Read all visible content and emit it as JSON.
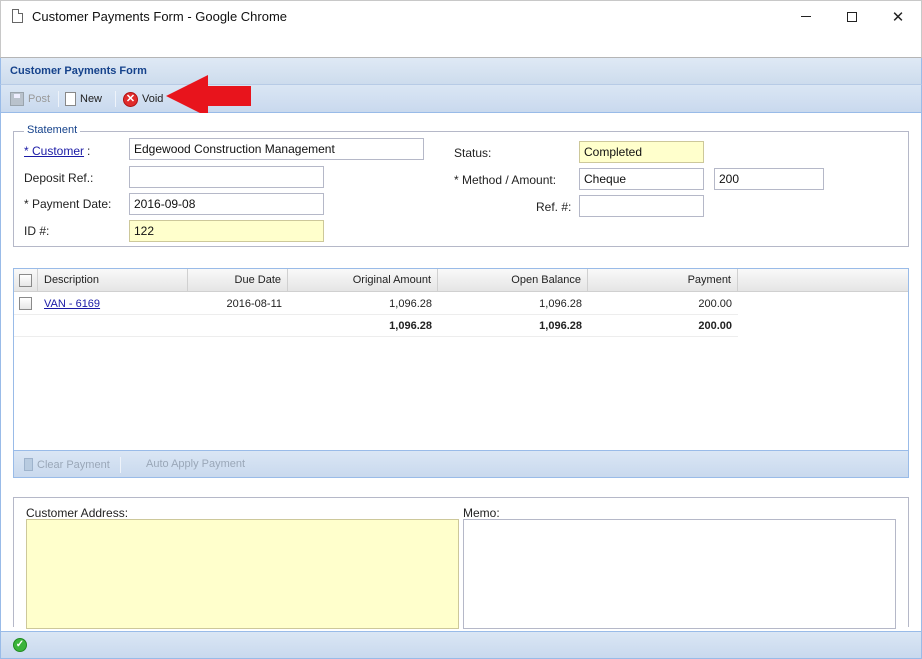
{
  "window": {
    "title": "Customer Payments Form - Google Chrome",
    "minimize_glyph": "",
    "maximize_glyph": "",
    "close_glyph": "✕"
  },
  "panel": {
    "title": "Customer Payments Form"
  },
  "toolbar": {
    "post_label": "Post",
    "new_label": "New",
    "void_label": "Void"
  },
  "statement": {
    "legend": "Statement",
    "customer_label": "* Customer",
    "customer_value": "Edgewood Construction Management",
    "deposit_ref_label": "Deposit Ref.:",
    "deposit_ref_value": "",
    "payment_date_label": "* Payment Date:",
    "payment_date_value": "2016-09-08",
    "id_label": "ID #:",
    "id_value": "122",
    "status_label": "Status:",
    "status_value": "Completed",
    "method_amount_label": "* Method / Amount:",
    "method_value": "Cheque",
    "amount_value": "200",
    "ref_label": "Ref. #:",
    "ref_value": ""
  },
  "grid": {
    "columns": [
      "Description",
      "Due Date",
      "Original Amount",
      "Open Balance",
      "Payment"
    ],
    "rows": [
      {
        "description": "VAN - 6169",
        "due_date": "2016-08-11",
        "original_amount": "1,096.28",
        "open_balance": "1,096.28",
        "payment": "200.00"
      }
    ],
    "totals": {
      "original_amount": "1,096.28",
      "open_balance": "1,096.28",
      "payment": "200.00"
    },
    "clear_payment_label": "Clear Payment",
    "auto_apply_label": "Auto Apply Payment"
  },
  "bottom": {
    "customer_address_label": "Customer Address:",
    "memo_label": "Memo:",
    "customer_address_value": "",
    "memo_value": ""
  },
  "colors": {
    "panel_border": "#99bbe8",
    "header_text": "#15428b",
    "readonly_bg": "#ffffcc",
    "annotation_arrow": "#e8141c"
  }
}
